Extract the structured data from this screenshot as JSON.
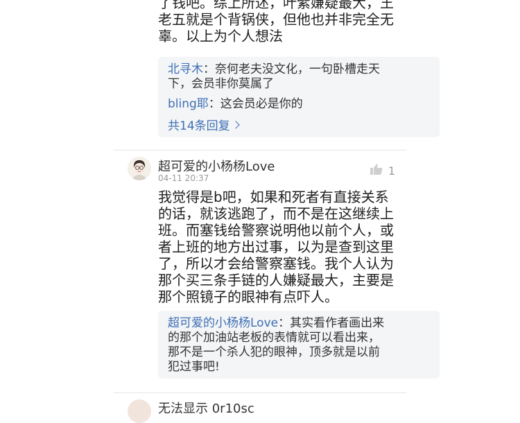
{
  "previous_comment": {
    "text_lines": [
      "了钱吧。综上所述，叶紫嫌疑最大，王",
      "老五就是个背锅侠，但他也并非完全无",
      "辜。以上为个人想法"
    ],
    "replies": [
      {
        "name": "北寻木",
        "text_lines": [
          "：奈何老夫没文化，一句卧槽走天",
          "下，会员非你莫属了"
        ]
      },
      {
        "name": "bling耶",
        "text_lines": [
          "：这会员必是你的"
        ]
      }
    ],
    "more_label": "共14条回复"
  },
  "comment": {
    "username": "超可爱的小杨杨Love",
    "time": "04-11 20:37",
    "likes": "1",
    "text_lines": [
      "我觉得是b吧，如果和死者有直接关系",
      "的话，就该逃跑了，而不是在这继续上",
      "班。而塞钱给警察说明他以前个人，或",
      "者上班的地方出过事，以为是查到这里",
      "了，所以才会给警察塞钱。我个人认为",
      "那个买三条手链的人嫌疑最大，主要是",
      "那个照镜子的眼神有点吓人。"
    ],
    "reply": {
      "name": "超可爱的小杨杨Love",
      "text_lines": [
        "：其实看作者画出来",
        "的那个加油站老板的表情就可以看出来，",
        "那不是一个杀人犯的眼神，顶多就是以前",
        "犯过事吧!"
      ]
    }
  },
  "next_comment": {
    "partial_username": "无法显示 0r10sc"
  },
  "colors": {
    "link": "#3f6fb3",
    "reply_bg": "#f3f5f7",
    "meta": "#999999"
  },
  "icons": {
    "like": "thumbs-up-icon",
    "more": "chevron-right-icon"
  }
}
